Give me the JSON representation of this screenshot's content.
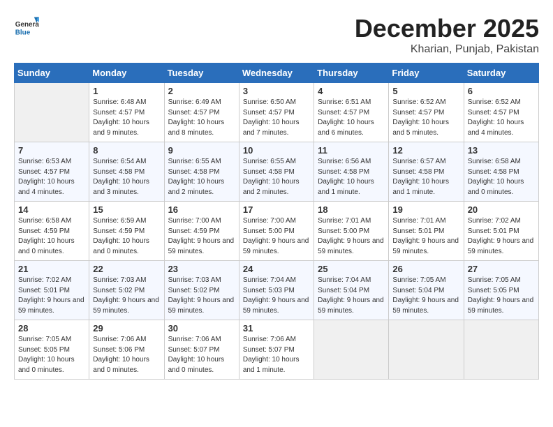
{
  "header": {
    "logo_text_general": "General",
    "logo_text_blue": "Blue",
    "month": "December 2025",
    "location": "Kharian, Punjab, Pakistan"
  },
  "weekdays": [
    "Sunday",
    "Monday",
    "Tuesday",
    "Wednesday",
    "Thursday",
    "Friday",
    "Saturday"
  ],
  "weeks": [
    [
      {
        "day": "",
        "empty": true
      },
      {
        "day": "1",
        "sunrise": "6:48 AM",
        "sunset": "4:57 PM",
        "daylight": "10 hours and 9 minutes."
      },
      {
        "day": "2",
        "sunrise": "6:49 AM",
        "sunset": "4:57 PM",
        "daylight": "10 hours and 8 minutes."
      },
      {
        "day": "3",
        "sunrise": "6:50 AM",
        "sunset": "4:57 PM",
        "daylight": "10 hours and 7 minutes."
      },
      {
        "day": "4",
        "sunrise": "6:51 AM",
        "sunset": "4:57 PM",
        "daylight": "10 hours and 6 minutes."
      },
      {
        "day": "5",
        "sunrise": "6:52 AM",
        "sunset": "4:57 PM",
        "daylight": "10 hours and 5 minutes."
      },
      {
        "day": "6",
        "sunrise": "6:52 AM",
        "sunset": "4:57 PM",
        "daylight": "10 hours and 4 minutes."
      }
    ],
    [
      {
        "day": "7",
        "sunrise": "6:53 AM",
        "sunset": "4:57 PM",
        "daylight": "10 hours and 4 minutes."
      },
      {
        "day": "8",
        "sunrise": "6:54 AM",
        "sunset": "4:58 PM",
        "daylight": "10 hours and 3 minutes."
      },
      {
        "day": "9",
        "sunrise": "6:55 AM",
        "sunset": "4:58 PM",
        "daylight": "10 hours and 2 minutes."
      },
      {
        "day": "10",
        "sunrise": "6:55 AM",
        "sunset": "4:58 PM",
        "daylight": "10 hours and 2 minutes."
      },
      {
        "day": "11",
        "sunrise": "6:56 AM",
        "sunset": "4:58 PM",
        "daylight": "10 hours and 1 minute."
      },
      {
        "day": "12",
        "sunrise": "6:57 AM",
        "sunset": "4:58 PM",
        "daylight": "10 hours and 1 minute."
      },
      {
        "day": "13",
        "sunrise": "6:58 AM",
        "sunset": "4:58 PM",
        "daylight": "10 hours and 0 minutes."
      }
    ],
    [
      {
        "day": "14",
        "sunrise": "6:58 AM",
        "sunset": "4:59 PM",
        "daylight": "10 hours and 0 minutes."
      },
      {
        "day": "15",
        "sunrise": "6:59 AM",
        "sunset": "4:59 PM",
        "daylight": "10 hours and 0 minutes."
      },
      {
        "day": "16",
        "sunrise": "7:00 AM",
        "sunset": "4:59 PM",
        "daylight": "9 hours and 59 minutes."
      },
      {
        "day": "17",
        "sunrise": "7:00 AM",
        "sunset": "5:00 PM",
        "daylight": "9 hours and 59 minutes."
      },
      {
        "day": "18",
        "sunrise": "7:01 AM",
        "sunset": "5:00 PM",
        "daylight": "9 hours and 59 minutes."
      },
      {
        "day": "19",
        "sunrise": "7:01 AM",
        "sunset": "5:01 PM",
        "daylight": "9 hours and 59 minutes."
      },
      {
        "day": "20",
        "sunrise": "7:02 AM",
        "sunset": "5:01 PM",
        "daylight": "9 hours and 59 minutes."
      }
    ],
    [
      {
        "day": "21",
        "sunrise": "7:02 AM",
        "sunset": "5:01 PM",
        "daylight": "9 hours and 59 minutes."
      },
      {
        "day": "22",
        "sunrise": "7:03 AM",
        "sunset": "5:02 PM",
        "daylight": "9 hours and 59 minutes."
      },
      {
        "day": "23",
        "sunrise": "7:03 AM",
        "sunset": "5:02 PM",
        "daylight": "9 hours and 59 minutes."
      },
      {
        "day": "24",
        "sunrise": "7:04 AM",
        "sunset": "5:03 PM",
        "daylight": "9 hours and 59 minutes."
      },
      {
        "day": "25",
        "sunrise": "7:04 AM",
        "sunset": "5:04 PM",
        "daylight": "9 hours and 59 minutes."
      },
      {
        "day": "26",
        "sunrise": "7:05 AM",
        "sunset": "5:04 PM",
        "daylight": "9 hours and 59 minutes."
      },
      {
        "day": "27",
        "sunrise": "7:05 AM",
        "sunset": "5:05 PM",
        "daylight": "9 hours and 59 minutes."
      }
    ],
    [
      {
        "day": "28",
        "sunrise": "7:05 AM",
        "sunset": "5:05 PM",
        "daylight": "10 hours and 0 minutes."
      },
      {
        "day": "29",
        "sunrise": "7:06 AM",
        "sunset": "5:06 PM",
        "daylight": "10 hours and 0 minutes."
      },
      {
        "day": "30",
        "sunrise": "7:06 AM",
        "sunset": "5:07 PM",
        "daylight": "10 hours and 0 minutes."
      },
      {
        "day": "31",
        "sunrise": "7:06 AM",
        "sunset": "5:07 PM",
        "daylight": "10 hours and 1 minute."
      },
      {
        "day": "",
        "empty": true
      },
      {
        "day": "",
        "empty": true
      },
      {
        "day": "",
        "empty": true
      }
    ]
  ]
}
